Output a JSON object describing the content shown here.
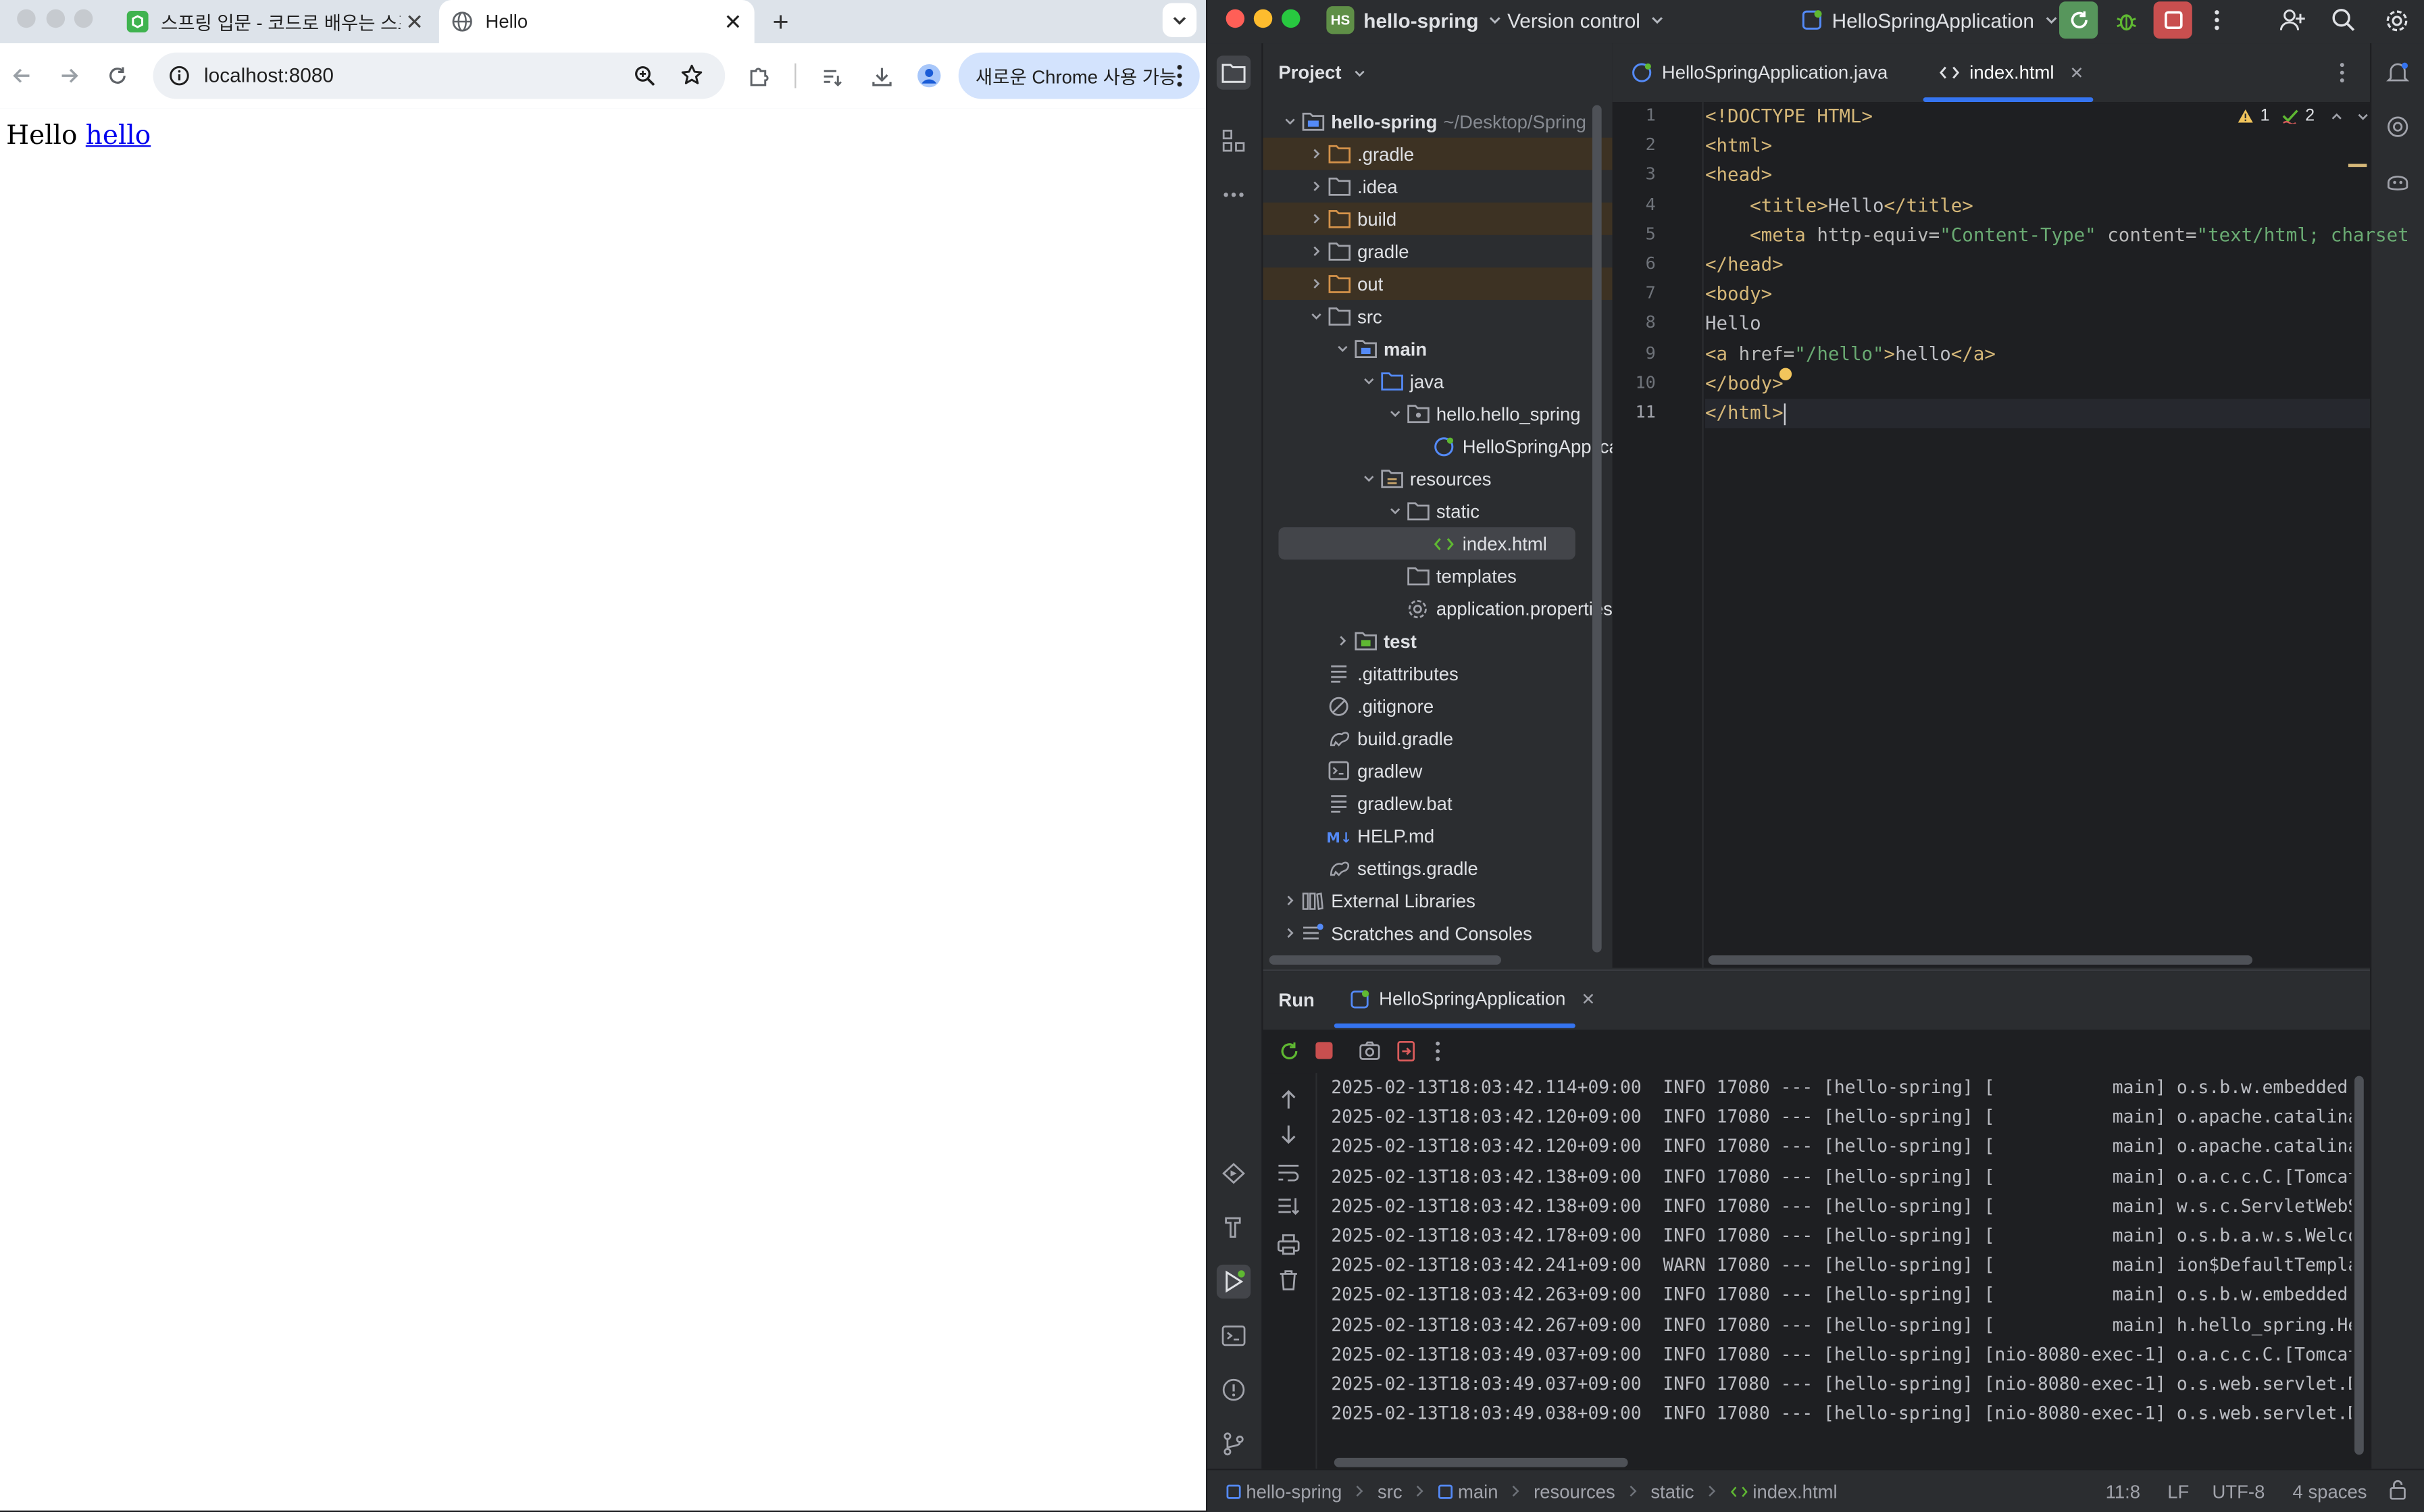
{
  "browser": {
    "tabs": [
      {
        "title": "스프링 입문 - 코드로 배우는 스프링",
        "active": false
      },
      {
        "title": "Hello",
        "active": true
      }
    ],
    "url": "localhost:8080",
    "update_pill": "새로운 Chrome 사용 가능",
    "page": {
      "text": "Hello",
      "link": "hello"
    }
  },
  "ide": {
    "project_badge": "HS",
    "project_name": "hello-spring",
    "vcs": "Version control",
    "run_config": "HelloSpringApplication",
    "project_panel_title": "Project",
    "tree": [
      {
        "label": "hello-spring",
        "path": "~/Desktop/Spring",
        "depth": 0,
        "expanded": true,
        "kind": "module",
        "bold": true
      },
      {
        "label": ".gradle",
        "depth": 1,
        "expanded": false,
        "kind": "folder-excluded"
      },
      {
        "label": ".idea",
        "depth": 1,
        "expanded": false,
        "kind": "folder"
      },
      {
        "label": "build",
        "depth": 1,
        "expanded": false,
        "kind": "folder-excluded"
      },
      {
        "label": "gradle",
        "depth": 1,
        "expanded": false,
        "kind": "folder"
      },
      {
        "label": "out",
        "depth": 1,
        "expanded": false,
        "kind": "folder-excluded"
      },
      {
        "label": "src",
        "depth": 1,
        "expanded": true,
        "kind": "folder"
      },
      {
        "label": "main",
        "depth": 2,
        "expanded": true,
        "kind": "folder-source",
        "bold": true
      },
      {
        "label": "java",
        "depth": 3,
        "expanded": true,
        "kind": "folder-java"
      },
      {
        "label": "hello.hello_spring",
        "depth": 4,
        "expanded": true,
        "kind": "package"
      },
      {
        "label": "HelloSpringApplication",
        "depth": 5,
        "kind": "spring-class"
      },
      {
        "label": "resources",
        "depth": 3,
        "expanded": true,
        "kind": "folder-res"
      },
      {
        "label": "static",
        "depth": 4,
        "expanded": true,
        "kind": "folder"
      },
      {
        "label": "index.html",
        "depth": 5,
        "kind": "html",
        "selected": true
      },
      {
        "label": "templates",
        "depth": 4,
        "kind": "folder"
      },
      {
        "label": "application.properties",
        "depth": 4,
        "kind": "settings"
      },
      {
        "label": "test",
        "depth": 2,
        "expanded": false,
        "kind": "folder-test",
        "bold": true
      },
      {
        "label": ".gitattributes",
        "depth": 1,
        "kind": "text"
      },
      {
        "label": ".gitignore",
        "depth": 1,
        "kind": "ignore"
      },
      {
        "label": "build.gradle",
        "depth": 1,
        "kind": "gradle"
      },
      {
        "label": "gradlew",
        "depth": 1,
        "kind": "terminal"
      },
      {
        "label": "gradlew.bat",
        "depth": 1,
        "kind": "text"
      },
      {
        "label": "HELP.md",
        "depth": 1,
        "kind": "md"
      },
      {
        "label": "settings.gradle",
        "depth": 1,
        "kind": "gradle"
      },
      {
        "label": "External Libraries",
        "depth": 0,
        "expanded": false,
        "kind": "library"
      },
      {
        "label": "Scratches and Consoles",
        "depth": 0,
        "expanded": false,
        "kind": "scratch"
      }
    ],
    "editor_tabs": [
      {
        "label": "HelloSpringApplication.java",
        "active": false
      },
      {
        "label": "index.html",
        "active": true
      }
    ],
    "inspections": {
      "warnings": "1",
      "typos": "2"
    },
    "code": [
      [
        {
          "t": "tag",
          "s": "<!DOCTYPE HTML>"
        }
      ],
      [
        {
          "t": "tag",
          "s": "<html>"
        }
      ],
      [
        {
          "t": "tag",
          "s": "<head>"
        }
      ],
      [
        {
          "t": "txt",
          "s": "    "
        },
        {
          "t": "tag",
          "s": "<title>"
        },
        {
          "t": "txt",
          "s": "Hello"
        },
        {
          "t": "tag",
          "s": "</title>"
        }
      ],
      [
        {
          "t": "txt",
          "s": "    "
        },
        {
          "t": "tag",
          "s": "<meta "
        },
        {
          "t": "attr",
          "s": "http-equiv="
        },
        {
          "t": "val",
          "s": "\"Content-Type\""
        },
        {
          "t": "attr",
          "s": " content="
        },
        {
          "t": "val",
          "s": "\"text/html; charset"
        }
      ],
      [
        {
          "t": "tag",
          "s": "</head>"
        }
      ],
      [
        {
          "t": "tag",
          "s": "<body>"
        }
      ],
      [
        {
          "t": "txt",
          "s": "Hello"
        }
      ],
      [
        {
          "t": "tag",
          "s": "<a "
        },
        {
          "t": "attr",
          "s": "href="
        },
        {
          "t": "val",
          "s": "\"/hello\""
        },
        {
          "t": "tag",
          "s": ">"
        },
        {
          "t": "txt",
          "s": "hello"
        },
        {
          "t": "tag",
          "s": "</a>"
        }
      ],
      [
        {
          "t": "tag",
          "s": "</body>"
        }
      ],
      [
        {
          "t": "tag",
          "s": "</html>"
        }
      ]
    ],
    "line_numbers": [
      "1",
      "2",
      "3",
      "4",
      "5",
      "6",
      "7",
      "8",
      "9",
      "10",
      "11"
    ],
    "run": {
      "title": "Run",
      "tab": "HelloSpringApplication",
      "log": [
        "2025-02-13T18:03:42.114+09:00  INFO 17080 --- [hello-spring] [           main] o.s.b.w.embedded.t",
        "2025-02-13T18:03:42.120+09:00  INFO 17080 --- [hello-spring] [           main] o.apache.catalina.",
        "2025-02-13T18:03:42.120+09:00  INFO 17080 --- [hello-spring] [           main] o.apache.catalina.",
        "2025-02-13T18:03:42.138+09:00  INFO 17080 --- [hello-spring] [           main] o.a.c.c.C.[Tomcat]",
        "2025-02-13T18:03:42.138+09:00  INFO 17080 --- [hello-spring] [           main] w.s.c.ServletWebSe",
        "2025-02-13T18:03:42.178+09:00  INFO 17080 --- [hello-spring] [           main] o.s.b.a.w.s.Welcom",
        "2025-02-13T18:03:42.241+09:00  WARN 17080 --- [hello-spring] [           main] ion$DefaultTemplat",
        "2025-02-13T18:03:42.263+09:00  INFO 17080 --- [hello-spring] [           main] o.s.b.w.embedded.t",
        "2025-02-13T18:03:42.267+09:00  INFO 17080 --- [hello-spring] [           main] h.hello_spring.Hel",
        "2025-02-13T18:03:49.037+09:00  INFO 17080 --- [hello-spring] [nio-8080-exec-1] o.a.c.c.C.[Tomcat]",
        "2025-02-13T18:03:49.037+09:00  INFO 17080 --- [hello-spring] [nio-8080-exec-1] o.s.web.servlet.Di",
        "2025-02-13T18:03:49.038+09:00  INFO 17080 --- [hello-spring] [nio-8080-exec-1] o.s.web.servlet.Di"
      ]
    },
    "breadcrumb": [
      "hello-spring",
      "src",
      "main",
      "resources",
      "static",
      "index.html"
    ],
    "status": {
      "position": "11:8",
      "line_sep": "LF",
      "encoding": "UTF-8",
      "indent": "4 spaces"
    }
  }
}
